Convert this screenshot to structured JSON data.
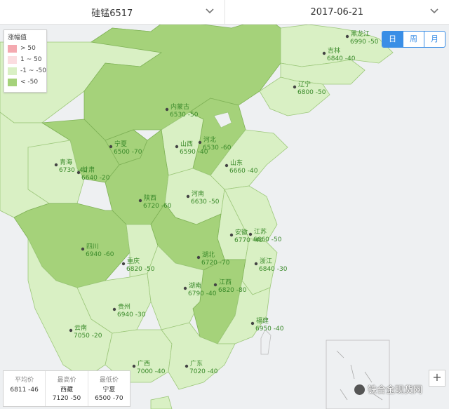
{
  "product_select": {
    "value": "硅锰6517"
  },
  "date_select": {
    "value": "2017-06-21"
  },
  "legend": {
    "title": "涨幅值",
    "items": [
      {
        "label": "> 50",
        "color": "#f4a9b0"
      },
      {
        "label": "1 ~ 50",
        "color": "#fbdde0"
      },
      {
        "label": "-1 ~ -50",
        "color": "#d9f0c4"
      },
      {
        "label": "< -50",
        "color": "#a5d27a"
      }
    ]
  },
  "period_toggle": {
    "items": [
      "日",
      "周",
      "月"
    ],
    "active": "日"
  },
  "provinces": [
    {
      "name": "黑龙江",
      "value": "6990 -50",
      "level": "light"
    },
    {
      "name": "吉林",
      "value": "6840 -40",
      "level": "light"
    },
    {
      "name": "辽宁",
      "value": "6800 -50",
      "level": "light"
    },
    {
      "name": "内蒙古",
      "value": "6530 -50",
      "level": "light"
    },
    {
      "name": "宁夏",
      "value": "6500 -70",
      "level": "dark"
    },
    {
      "name": "山西",
      "value": "6590 -40",
      "level": "light"
    },
    {
      "name": "河北",
      "value": "6530 -60",
      "level": "dark"
    },
    {
      "name": "山东",
      "value": "6660 -40",
      "level": "light"
    },
    {
      "name": "青海",
      "value": "6730 -40",
      "level": "light"
    },
    {
      "name": "甘肃",
      "value": "6640 -20",
      "level": "light"
    },
    {
      "name": "陕西",
      "value": "6720 -60",
      "level": "dark"
    },
    {
      "name": "河南",
      "value": "6630 -50",
      "level": "light"
    },
    {
      "name": "安徽",
      "value": "6770 -40",
      "level": "light"
    },
    {
      "name": "江苏",
      "value": "6660 -50",
      "level": "light"
    },
    {
      "name": "四川",
      "value": "6940 -60",
      "level": "dark"
    },
    {
      "name": "重庆",
      "value": "6820 -50",
      "level": "light"
    },
    {
      "name": "湖北",
      "value": "6720 -70",
      "level": "dark"
    },
    {
      "name": "浙江",
      "value": "6840 -30",
      "level": "light"
    },
    {
      "name": "湖南",
      "value": "6790 -40",
      "level": "light"
    },
    {
      "name": "江西",
      "value": "6820 -80",
      "level": "dark"
    },
    {
      "name": "贵州",
      "value": "6940 -30",
      "level": "light"
    },
    {
      "name": "福建",
      "value": "6950 -40",
      "level": "light"
    },
    {
      "name": "云南",
      "value": "7050 -20",
      "level": "light"
    },
    {
      "name": "广西",
      "value": "7000 -40",
      "level": "light"
    },
    {
      "name": "广东",
      "value": "7020 -40",
      "level": "light"
    }
  ],
  "stats": {
    "avg": {
      "label": "平均价",
      "value": "6811 -46"
    },
    "high": {
      "label": "最高价",
      "region": "西藏",
      "value": "7120 -50"
    },
    "low": {
      "label": "最低价",
      "region": "宁夏",
      "value": "6500 -70"
    }
  },
  "zoom": {
    "label": "+"
  },
  "watermark": {
    "text": "铁合金现货网"
  }
}
